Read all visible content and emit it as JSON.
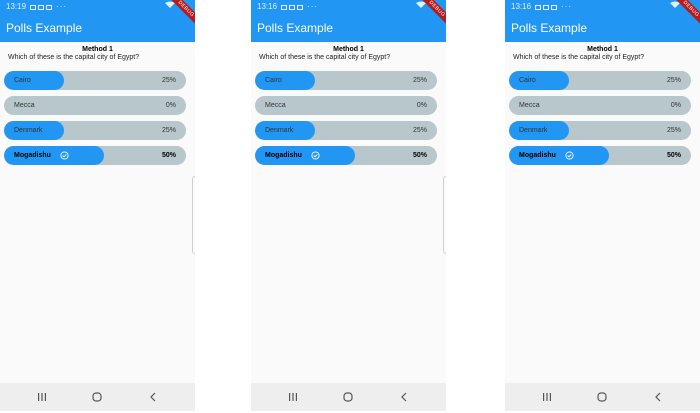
{
  "screens": [
    {
      "status": {
        "time": "13:19",
        "glyphs": 3,
        "dots": "···"
      },
      "app": {
        "title": "Polls Example",
        "debug_label": "DEBUG"
      },
      "method": "Method 1",
      "question": "Which of these is the capital city of Egypt?",
      "options": [
        {
          "label": "Cairo",
          "percent": "25%",
          "fraction": 0.25,
          "selected": false
        },
        {
          "label": "Mecca",
          "percent": "0%",
          "fraction": 0.0,
          "selected": false
        },
        {
          "label": "Denmark",
          "percent": "25%",
          "fraction": 0.25,
          "selected": false
        },
        {
          "label": "Mogadishu",
          "percent": "50%",
          "fraction": 0.5,
          "selected": true
        }
      ],
      "has_edge_tab": true
    },
    {
      "status": {
        "time": "13:16",
        "glyphs": 3,
        "dots": "···"
      },
      "app": {
        "title": "Polls Example",
        "debug_label": "DEBUG"
      },
      "method": "Method 1",
      "question": "Which of these is the capital city of Egypt?",
      "options": [
        {
          "label": "Cairo",
          "percent": "25%",
          "fraction": 0.25,
          "selected": false
        },
        {
          "label": "Mecca",
          "percent": "0%",
          "fraction": 0.0,
          "selected": false
        },
        {
          "label": "Denmark",
          "percent": "25%",
          "fraction": 0.25,
          "selected": false
        },
        {
          "label": "Mogadishu",
          "percent": "50%",
          "fraction": 0.5,
          "selected": true
        }
      ],
      "has_edge_tab": true
    },
    {
      "status": {
        "time": "13:16",
        "glyphs": 3,
        "dots": "···"
      },
      "app": {
        "title": "Polls Example",
        "debug_label": "DEBUG"
      },
      "method": "Method 1",
      "question": "Which of these is the capital city of Egypt?",
      "options": [
        {
          "label": "Cairo",
          "percent": "25%",
          "fraction": 0.25,
          "selected": false
        },
        {
          "label": "Mecca",
          "percent": "0%",
          "fraction": 0.0,
          "selected": false
        },
        {
          "label": "Denmark",
          "percent": "25%",
          "fraction": 0.25,
          "selected": false
        },
        {
          "label": "Mogadishu",
          "percent": "50%",
          "fraction": 0.5,
          "selected": true
        }
      ],
      "has_edge_tab": false
    }
  ],
  "colors": {
    "primary": "#2196f3",
    "track": "#b8c7cc",
    "debug_ribbon": "#b71c1c",
    "navbar": "#eeeeee"
  },
  "icons": {
    "selected_marker": "check-circle-icon",
    "nav": [
      "recents-icon",
      "home-icon",
      "back-icon"
    ]
  }
}
